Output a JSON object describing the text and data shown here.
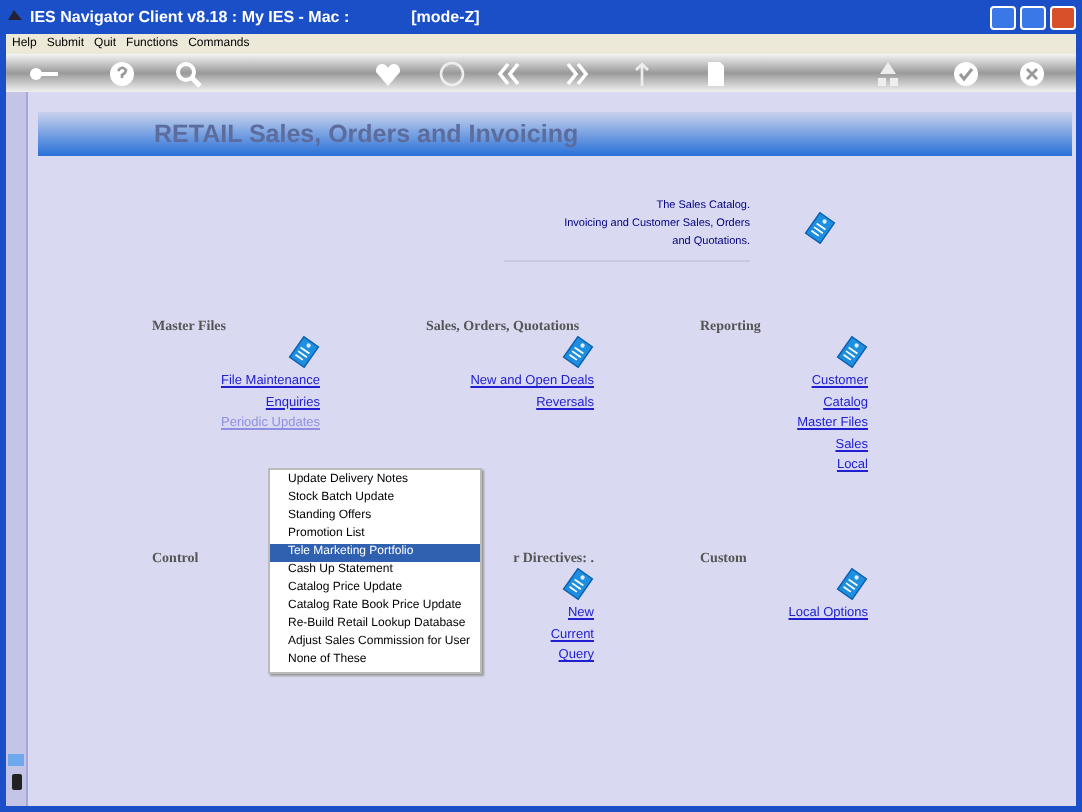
{
  "window": {
    "title": "IES Navigator Client v8.18 : My IES - Mac :",
    "mode": "[mode-Z]"
  },
  "menu": [
    "Help",
    "Submit",
    "Quit",
    "Functions",
    "Commands"
  ],
  "banner": {
    "title": "RETAIL Sales, Orders and Invoicing"
  },
  "description": [
    "The Sales Catalog.",
    "Invoicing and Customer Sales, Orders",
    "and Quotations."
  ],
  "sections": [
    {
      "heading": "Master Files",
      "links": [
        {
          "label": "File Maintenance",
          "hovered": false
        },
        {
          "label": "Enquiries",
          "hovered": false
        },
        {
          "label": "Periodic Updates",
          "hovered": true
        }
      ]
    },
    {
      "heading": "Sales, Orders, Quotations",
      "links": [
        {
          "label": "New and Open Deals",
          "hovered": false
        },
        {
          "label": "Reversals",
          "hovered": false
        }
      ]
    },
    {
      "heading": "Reporting",
      "links": [
        {
          "label": "Customer",
          "hovered": false
        },
        {
          "label": "Catalog",
          "hovered": false
        },
        {
          "label": "Master Files",
          "hovered": false
        },
        {
          "label": "Sales",
          "hovered": false
        },
        {
          "label": "Local",
          "hovered": false
        }
      ]
    },
    {
      "heading": "Control"
    },
    {
      "heading": "r Directives: .",
      "links": [
        {
          "label": "New",
          "hovered": false
        },
        {
          "label": "Current",
          "hovered": false
        },
        {
          "label": "Query",
          "hovered": false
        }
      ]
    },
    {
      "heading": "Custom",
      "links": [
        {
          "label": "Local Options",
          "hovered": false
        }
      ]
    }
  ],
  "popup_menu": [
    {
      "label": "Update Delivery Notes",
      "selected": false
    },
    {
      "label": "Stock Batch Update",
      "selected": false
    },
    {
      "label": "Standing Offers",
      "selected": false
    },
    {
      "label": "Promotion List",
      "selected": false
    },
    {
      "label": "Tele Marketing Portfolio",
      "selected": true
    },
    {
      "label": "Cash Up Statement",
      "selected": false
    },
    {
      "label": "Catalog Price Update",
      "selected": false
    },
    {
      "label": "Catalog Rate Book Price Update",
      "selected": false
    },
    {
      "label": "Re-Build Retail Lookup Database",
      "selected": false
    },
    {
      "label": "Adjust Sales Commission for User",
      "selected": false
    },
    {
      "label": "None of These",
      "selected": false
    }
  ]
}
